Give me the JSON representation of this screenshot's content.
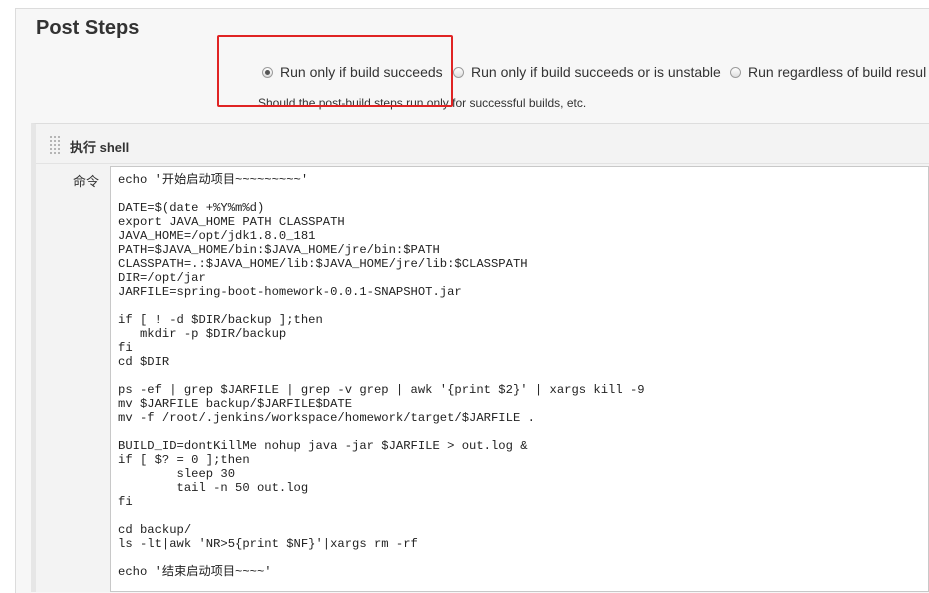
{
  "section": {
    "title": "Post Steps"
  },
  "run_condition": {
    "options": [
      {
        "label": "Run only if build succeeds",
        "checked": true
      },
      {
        "label": "Run only if build succeeds or is unstable",
        "checked": false
      },
      {
        "label": "Run regardless of build resul",
        "checked": false
      }
    ],
    "hint": "Should the post-build steps run only for successful builds, etc."
  },
  "builder": {
    "title": "执行 shell",
    "command_label": "命令",
    "command_lines": [
      "echo '开始启动项目~~~~~~~~~'",
      "",
      "DATE=$(date +%Y%m%d)",
      "export JAVA_HOME PATH CLASSPATH",
      "JAVA_HOME=/opt/jdk1.8.0_181",
      "PATH=$JAVA_HOME/bin:$JAVA_HOME/jre/bin:$PATH",
      "CLASSPATH=.:$JAVA_HOME/lib:$JAVA_HOME/jre/lib:$CLASSPATH",
      "DIR=/opt/jar",
      "JARFILE=spring-boot-homework-0.0.1-SNAPSHOT.jar",
      "",
      "if [ ! -d $DIR/backup ];then",
      "   mkdir -p $DIR/backup",
      "fi",
      "cd $DIR",
      "",
      "ps -ef | grep $JARFILE | grep -v grep | awk '{print $2}' | xargs kill -9",
      "mv $JARFILE backup/$JARFILE$DATE",
      "mv -f /root/.jenkins/workspace/homework/target/$JARFILE .",
      "",
      "BUILD_ID=dontKillMe nohup java -jar $JARFILE > out.log &",
      "if [ $? = 0 ];then",
      "        sleep 30",
      "        tail -n 50 out.log",
      "fi",
      "",
      "cd backup/",
      "ls -lt|awk 'NR>5{print $NF}'|xargs rm -rf",
      "",
      "echo '结束启动项目~~~~'"
    ]
  },
  "colors": {
    "highlight": "#e02424",
    "section_bg": "#f7f7f7",
    "string": "#a31515"
  }
}
